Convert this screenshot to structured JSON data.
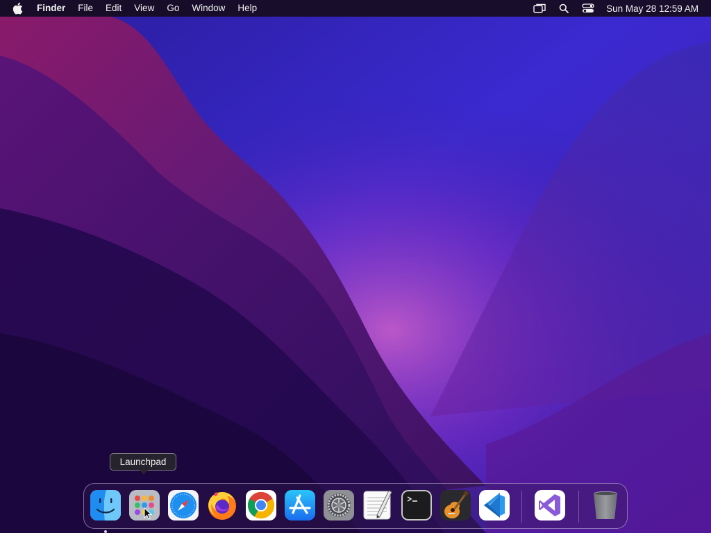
{
  "menubar": {
    "apple_icon": "apple-logo-icon",
    "app_name": "Finder",
    "menus": [
      "File",
      "Edit",
      "View",
      "Go",
      "Window",
      "Help"
    ],
    "status_icons": [
      "screen-mirroring-icon",
      "spotlight-search-icon",
      "control-center-icon"
    ],
    "clock": "Sun May 28  12:59 AM"
  },
  "tooltip": {
    "text": "Launchpad"
  },
  "dock": {
    "apps": [
      {
        "name": "Finder",
        "icon": "finder-icon",
        "running": true
      },
      {
        "name": "Launchpad",
        "icon": "launchpad-icon",
        "running": false
      },
      {
        "name": "Safari",
        "icon": "safari-icon",
        "running": false
      },
      {
        "name": "Firefox",
        "icon": "firefox-icon",
        "running": false
      },
      {
        "name": "Google Chrome",
        "icon": "chrome-icon",
        "running": false
      },
      {
        "name": "App Store",
        "icon": "app-store-icon",
        "running": false
      },
      {
        "name": "System Preferences",
        "icon": "system-preferences-icon",
        "running": false
      },
      {
        "name": "TextEdit",
        "icon": "textedit-icon",
        "running": false
      },
      {
        "name": "Terminal",
        "icon": "terminal-icon",
        "running": false
      },
      {
        "name": "GarageBand",
        "icon": "garageband-icon",
        "running": false
      },
      {
        "name": "Visual Studio Code",
        "icon": "vscode-icon",
        "running": false
      }
    ],
    "recent_apps": [
      {
        "name": "Visual Studio",
        "icon": "visual-studio-icon",
        "running": false
      }
    ],
    "trash": {
      "name": "Trash",
      "icon": "trash-icon"
    }
  },
  "colors": {
    "wallpaper_purple": "#3a1a8a",
    "wallpaper_magenta": "#a0208a",
    "menubar_bg": "#16101e"
  }
}
